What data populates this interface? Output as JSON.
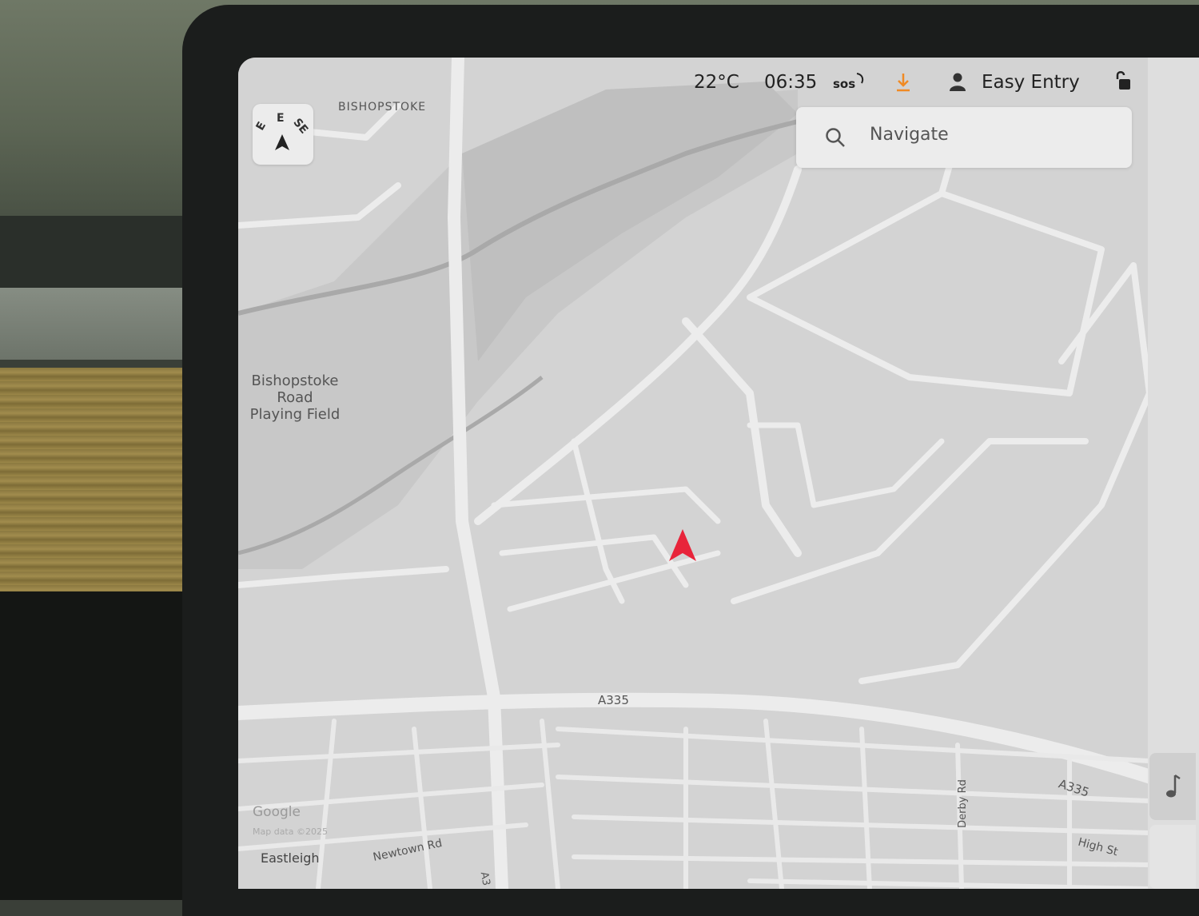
{
  "status": {
    "temperature": "22°C",
    "time": "06:35",
    "sos": "sos",
    "profile": "Easy Entry",
    "icons": [
      "sos-icon",
      "download-icon",
      "person-icon",
      "unlock-icon",
      "battery-icon"
    ],
    "download_color": "#f08a24",
    "battery_color": "#2ecc40"
  },
  "search": {
    "placeholder": "Navigate",
    "icon": "search-icon"
  },
  "compass": {
    "n": "E",
    "left": "E",
    "right": "SE"
  },
  "map": {
    "labels": {
      "town_top": "BISHOPSTOKE",
      "park_line1": "Bishopstoke",
      "park_line2": "Road",
      "park_line3": "Playing Field",
      "road_a335_center": "A335",
      "road_a335_right": "A335",
      "derby_rd": "Derby Rd",
      "high_st": "High St",
      "newtown_rd": "Newtown Rd",
      "a3_bottom": "A3",
      "eastleigh": "Eastleigh",
      "google": "Google",
      "map_data": "Map data ©2025"
    },
    "position_marker_color": "#e8243a"
  },
  "media": {
    "icon": "music-note-icon"
  }
}
